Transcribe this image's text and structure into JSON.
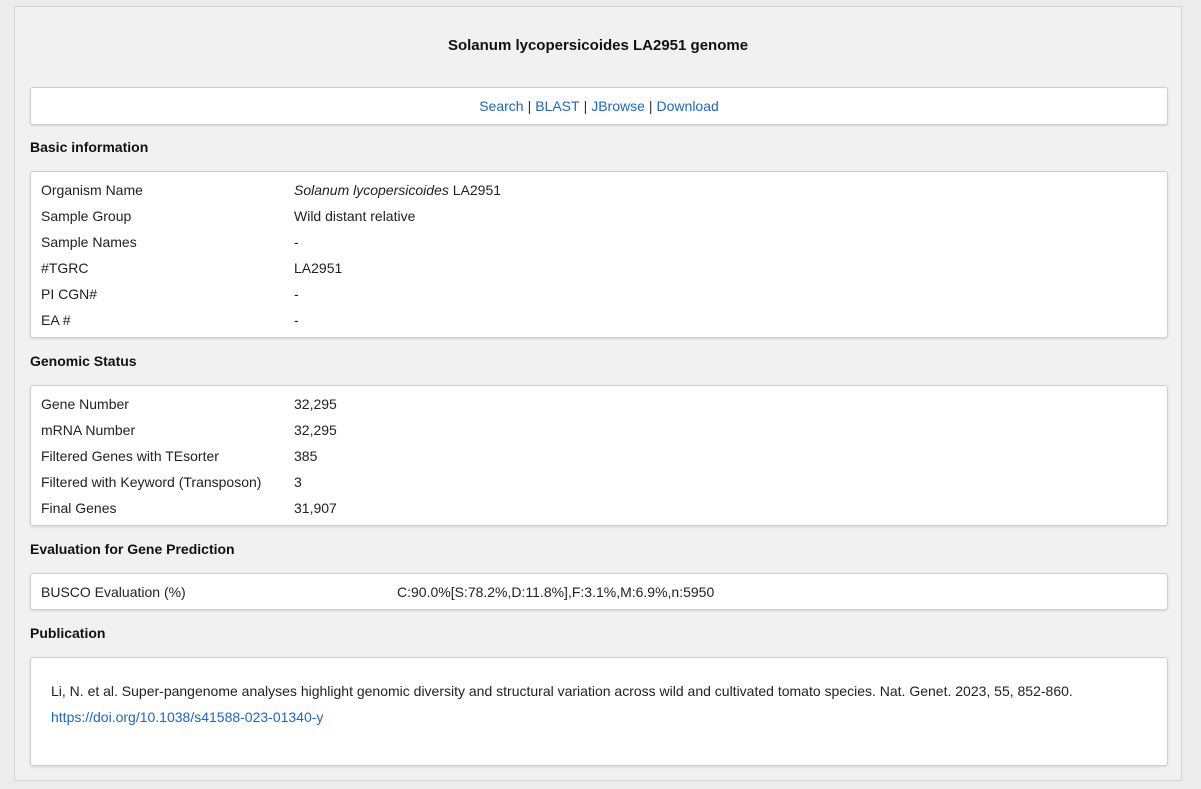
{
  "page": {
    "title": "Solanum lycopersicoides LA2951 genome"
  },
  "nav": {
    "search": "Search",
    "blast": "BLAST",
    "jbrowse": "JBrowse",
    "download": "Download",
    "separator": "|"
  },
  "basic": {
    "heading": "Basic information",
    "organism_label": "Organism Name",
    "organism_italic": "Solanum lycopersicoides",
    "organism_suffix": " LA2951",
    "rows": [
      {
        "label": "Sample Group",
        "value": "Wild distant relative"
      },
      {
        "label": "Sample Names",
        "value": "-"
      },
      {
        "label": "#TGRC",
        "value": "LA2951"
      },
      {
        "label": "PI CGN#",
        "value": "-"
      },
      {
        "label": "EA #",
        "value": "-"
      }
    ]
  },
  "genomic": {
    "heading": "Genomic Status",
    "rows": [
      {
        "label": "Gene Number",
        "value": "32,295"
      },
      {
        "label": "mRNA Number",
        "value": "32,295"
      },
      {
        "label": "Filtered Genes with TEsorter",
        "value": "385"
      },
      {
        "label": "Filtered with Keyword (Transposon)",
        "value": "3"
      },
      {
        "label": "Final Genes",
        "value": "31,907"
      }
    ]
  },
  "evaluation": {
    "heading": "Evaluation for Gene Prediction",
    "label": "BUSCO Evaluation (%)",
    "value": "C:90.0%[S:78.2%,D:11.8%],F:3.1%,M:6.9%,n:5950"
  },
  "publication": {
    "heading": "Publication",
    "citation": "Li, N. et al. Super-pangenome analyses highlight genomic diversity and structural variation across wild and cultivated tomato species. Nat. Genet. 2023, 55, 852-860.",
    "link": "https://doi.org/10.1038/s41588-023-01340-y"
  },
  "colors": {
    "link": "#1a66cc",
    "background": "#ececec",
    "card": "#ffffff"
  }
}
